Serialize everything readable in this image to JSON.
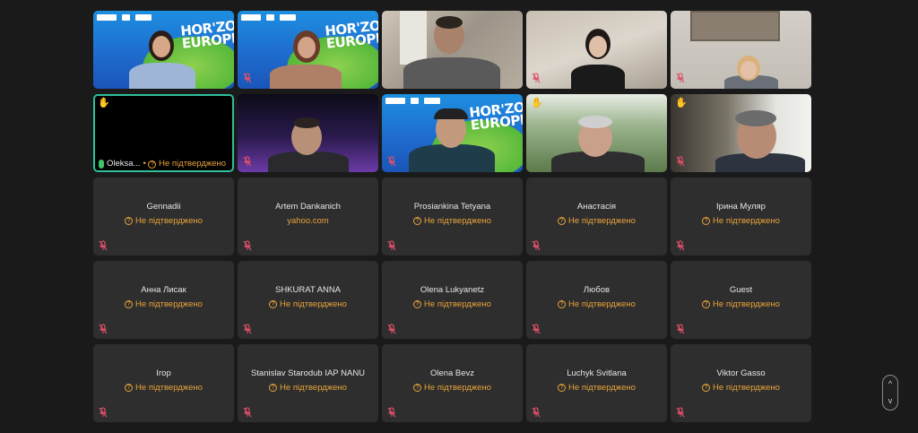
{
  "video_tiles": [
    {
      "id": "horizon-1",
      "background": "horizon",
      "horizon_text": "HOR'ZON EUROPE",
      "muted": false
    },
    {
      "id": "horizon-2",
      "background": "horizon",
      "horizon_text": "HOR'ZON EUROPE",
      "muted": true
    },
    {
      "id": "office-man",
      "background": "office",
      "muted": false
    },
    {
      "id": "young-woman",
      "background": "room",
      "muted": true
    },
    {
      "id": "woman-glasses",
      "background": "wall",
      "muted": true
    }
  ],
  "row2": {
    "oleksa": {
      "name": "Oleksa...",
      "status": "Не підтверджено",
      "hand_raised": true
    },
    "purple_man": {
      "muted": true
    },
    "horizon_headset": {
      "horizon_text": "HOR'ZON EUROPE",
      "muted": true
    },
    "older_man": {
      "hand_raised": true,
      "muted": false
    },
    "window_man": {
      "hand_raised": true,
      "muted": true
    }
  },
  "participants": [
    {
      "name": "Gennadii",
      "status": "Не підтверджено"
    },
    {
      "name": "Artem Dankanich",
      "status": "yahoo.com"
    },
    {
      "name": "Prosiankina Tetyana",
      "status": "Не підтверджено"
    },
    {
      "name": "Анастасія",
      "status": "Не підтверджено"
    },
    {
      "name": "Ірина Муляр",
      "status": "Не підтверджено"
    },
    {
      "name": "Анна Лисак",
      "status": "Не підтверджено"
    },
    {
      "name": "SHKURAT ANNA",
      "status": "Не підтверджено"
    },
    {
      "name": "Olena Lukyanetz",
      "status": "Не підтверджено"
    },
    {
      "name": "Любов",
      "status": "Не підтверджено"
    },
    {
      "name": "Guest",
      "status": "Не підтверджено"
    },
    {
      "name": "Ігор",
      "status": "Не підтверджено"
    },
    {
      "name": "Stanislav Starodub IAP NANU",
      "status": "Не підтверджено"
    },
    {
      "name": "Olena Bevz",
      "status": "Не підтверджено"
    },
    {
      "name": "Luchyk Svitlana",
      "status": "Не підтверджено"
    },
    {
      "name": "Viktor Gasso",
      "status": "Не підтверджено"
    }
  ],
  "colors": {
    "background": "#1a1a1a",
    "tile": "#2e2e2e",
    "status_orange": "#e8a33a",
    "active_speaker_border": "#2fbf9a",
    "muted_icon": "#e0506a"
  },
  "scroll": {
    "up": "^",
    "down": "v"
  }
}
